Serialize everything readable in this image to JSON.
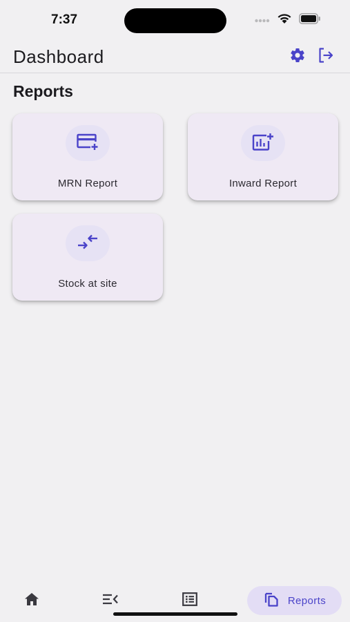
{
  "status_bar": {
    "time": "7:37",
    "icons": [
      "signal-icon",
      "wifi-icon",
      "battery-icon"
    ]
  },
  "app_bar": {
    "title": "Dashboard",
    "actions": [
      "settings-icon",
      "logout-icon"
    ]
  },
  "section": {
    "title": "Reports"
  },
  "cards": [
    {
      "label": "MRN Report",
      "icon": "card-add-icon"
    },
    {
      "label": "Inward Report",
      "icon": "chart-add-icon"
    },
    {
      "label": "Stock at site",
      "icon": "swap-arrows-icon"
    }
  ],
  "bottom_nav": {
    "items": [
      {
        "icon": "home-icon"
      },
      {
        "icon": "menu-list-icon"
      },
      {
        "icon": "list-box-icon"
      },
      {
        "icon": "copy-pages-icon",
        "label": "Reports",
        "active": true
      }
    ]
  },
  "colors": {
    "accent": "#4a43c9",
    "card_bg": "#efe9f4",
    "page_bg": "#f1f0f2"
  }
}
